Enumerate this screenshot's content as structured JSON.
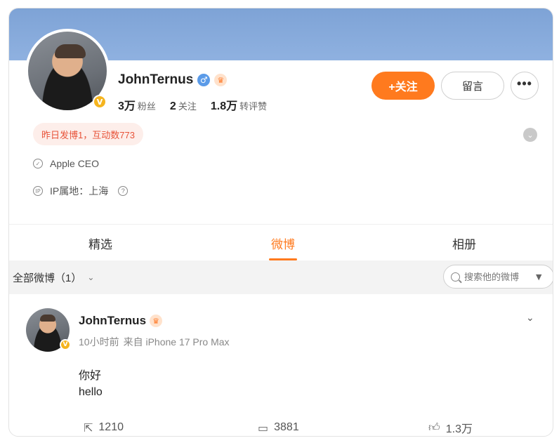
{
  "profile": {
    "name": "JohnTernus",
    "gender_icon": "male-icon",
    "gender_glyph": "♂",
    "badge_icon": "crown-badge-icon",
    "verified_glyph": "V",
    "stats": [
      {
        "num": "3万",
        "label": "粉丝"
      },
      {
        "num": "2",
        "label": "关注"
      },
      {
        "num": "1.8万",
        "label": "转评赞"
      }
    ],
    "follow_label": "+关注",
    "message_label": "留言",
    "more_label": "•••",
    "activity": "昨日发博1，互动数773",
    "bio": "Apple CEO",
    "ip_label": "IP属地：上海",
    "help_glyph": "?"
  },
  "tabs": [
    {
      "label": "精选"
    },
    {
      "label": "微博"
    },
    {
      "label": "相册"
    }
  ],
  "filter": {
    "label": "全部微博（1）",
    "chevron": "⌄",
    "search_placeholder": "搜索他的微博"
  },
  "post": {
    "author": "JohnTernus",
    "time": "10小时前",
    "source": "来自 iPhone 17 Pro Max",
    "lines": [
      "你好",
      "hello"
    ],
    "reposts": "1210",
    "comments": "3881",
    "likes": "1.3万"
  },
  "colors": {
    "accent": "#ff7a1e",
    "banner": "#8aabdc",
    "activity_bg": "#fdeeea",
    "activity_text": "#e8543a",
    "verified": "#f5b41e"
  }
}
